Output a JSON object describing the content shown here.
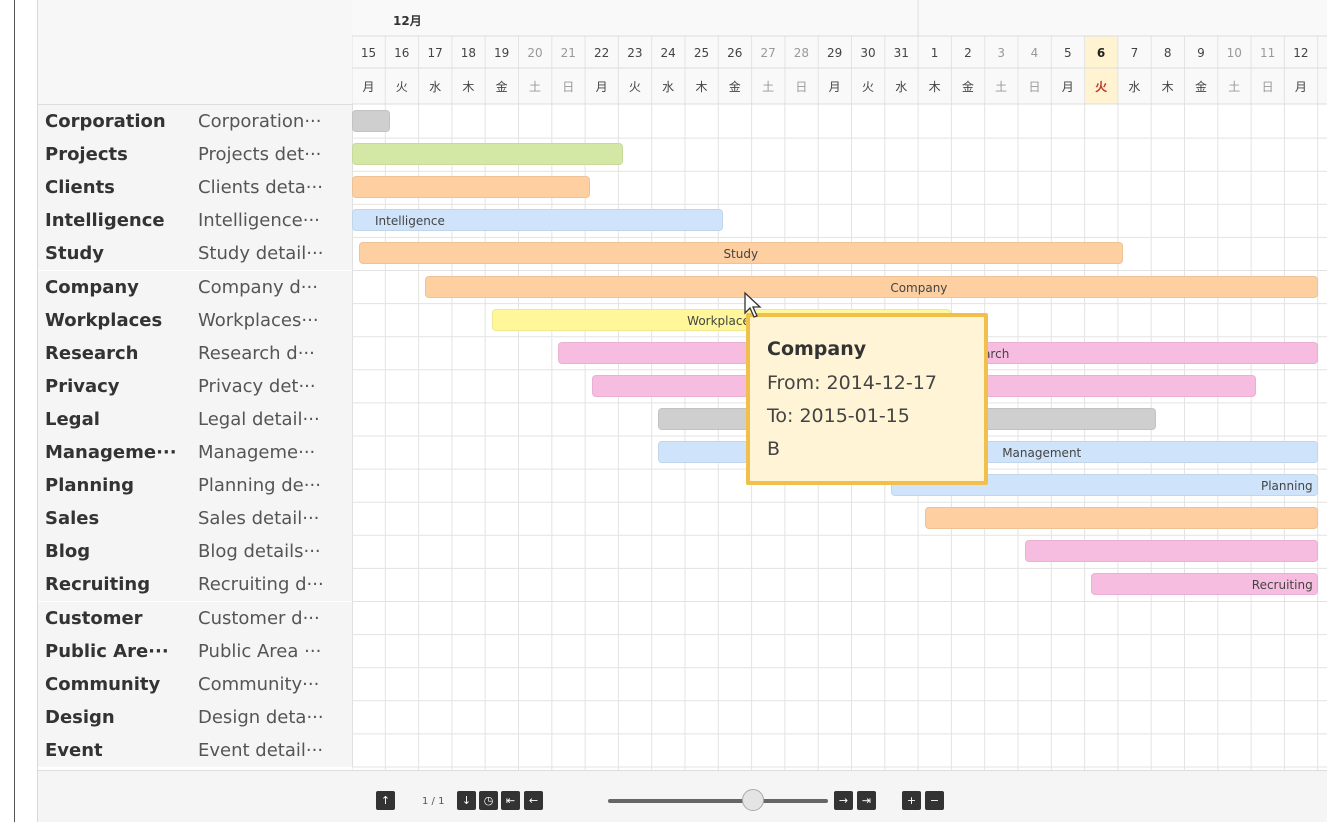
{
  "gantt": {
    "month_label": "12月",
    "days": [
      "15",
      "16",
      "17",
      "18",
      "19",
      "20",
      "21",
      "22",
      "23",
      "24",
      "25",
      "26",
      "27",
      "28",
      "29",
      "30",
      "31",
      "1",
      "2",
      "3",
      "4",
      "5",
      "6",
      "7",
      "8",
      "9",
      "10",
      "11",
      "12"
    ],
    "weekdays": [
      "月",
      "火",
      "水",
      "木",
      "金",
      "土",
      "日",
      "月",
      "火",
      "水",
      "木",
      "金",
      "土",
      "日",
      "月",
      "火",
      "水",
      "木",
      "金",
      "土",
      "日",
      "月",
      "火",
      "水",
      "木",
      "金",
      "土",
      "日",
      "月"
    ],
    "today_index": 22,
    "rows": [
      {
        "name": "Corporation",
        "desc": "Corporation···"
      },
      {
        "name": "Projects",
        "desc": "Projects det···"
      },
      {
        "name": "Clients",
        "desc": "Clients deta···"
      },
      {
        "name": "Intelligence",
        "desc": "Intelligence···"
      },
      {
        "name": "Study",
        "desc": "Study detail···"
      },
      {
        "name": "Company",
        "desc": "Company d···"
      },
      {
        "name": "Workplaces",
        "desc": "Workplaces···"
      },
      {
        "name": "Research",
        "desc": "Research d···"
      },
      {
        "name": "Privacy",
        "desc": "Privacy det···"
      },
      {
        "name": "Legal",
        "desc": "Legal detail···"
      },
      {
        "name": "Manageme···",
        "desc": "Manageme···"
      },
      {
        "name": "Planning",
        "desc": "Planning de···"
      },
      {
        "name": "Sales",
        "desc": "Sales detail···"
      },
      {
        "name": "Blog",
        "desc": "Blog details···"
      },
      {
        "name": "Recruiting",
        "desc": "Recruiting d···"
      },
      {
        "name": "Customer",
        "desc": "Customer d···"
      },
      {
        "name": "Public Are···",
        "desc": "Public Area ···"
      },
      {
        "name": "Community",
        "desc": "Community···"
      },
      {
        "name": "Design",
        "desc": "Design deta···"
      },
      {
        "name": "Event",
        "desc": "Event detail···"
      }
    ],
    "bars": [
      {
        "row": 0,
        "start": 0,
        "end": 1.15,
        "label": "",
        "color": "#cfcfcf",
        "label_pos": "center"
      },
      {
        "row": 1,
        "start": 0,
        "end": 8.15,
        "label": "",
        "color": "#d4e8a6",
        "label_pos": "center"
      },
      {
        "row": 2,
        "start": 0,
        "end": 7.15,
        "label": "",
        "color": "#fdcfa1",
        "label_pos": "center"
      },
      {
        "row": 3,
        "start": 0,
        "end": 11.15,
        "label": "Intelligence",
        "color": "#cfe4fa",
        "label_pos": "left"
      },
      {
        "row": 4,
        "start": 0.2,
        "end": 23.15,
        "label": "Study",
        "color": "#fdcfa1",
        "label_pos": "center"
      },
      {
        "row": 5,
        "start": 2.2,
        "end": 29,
        "label": "Company",
        "color": "#fdcfa1",
        "label_pos": "right"
      },
      {
        "row": 6,
        "start": 4.2,
        "end": 18,
        "label": "Workplaces",
        "color": "#fff79a",
        "label_pos": "center"
      },
      {
        "row": 7,
        "start": 6.2,
        "end": 29,
        "label": "Research",
        "color": "#f7bde0",
        "label_pos": "right"
      },
      {
        "row": 8,
        "start": 7.2,
        "end": 27.15,
        "label": "",
        "color": "#f7bde0",
        "label_pos": "center"
      },
      {
        "row": 9,
        "start": 9.2,
        "end": 24.15,
        "label": "",
        "color": "#cfcfcf",
        "label_pos": "center"
      },
      {
        "row": 10,
        "start": 9.2,
        "end": 29,
        "label": "Management",
        "color": "#cfe4fa",
        "label_pos": "right"
      },
      {
        "row": 11,
        "start": 16.2,
        "end": 29,
        "label": "Planning",
        "color": "#cfe4fa",
        "label_pos": "end"
      },
      {
        "row": 12,
        "start": 17.2,
        "end": 29,
        "label": "",
        "color": "#fdcfa1",
        "label_pos": "center"
      },
      {
        "row": 13,
        "start": 20.2,
        "end": 29,
        "label": "",
        "color": "#f7bde0",
        "label_pos": "center"
      },
      {
        "row": 14,
        "start": 22.2,
        "end": 29,
        "label": "Recruiting",
        "color": "#f7bde0",
        "label_pos": "end"
      }
    ]
  },
  "tooltip": {
    "title": "Company",
    "from": "From: 2014-12-17",
    "to": "To: 2015-01-15",
    "extra": "B"
  },
  "footer": {
    "page_indicator": "1 / 1",
    "zoom_level": 0.66,
    "buttons": [
      {
        "name": "row-up-button",
        "glyph": "↑"
      },
      {
        "name": "row-down-button",
        "glyph": "↓"
      },
      {
        "name": "today-button",
        "glyph": "◷"
      },
      {
        "name": "scroll-start-button",
        "glyph": "⇤"
      },
      {
        "name": "scroll-left-button",
        "glyph": "←"
      },
      {
        "name": "scroll-right-button",
        "glyph": "→"
      },
      {
        "name": "scroll-end-button",
        "glyph": "⇥"
      },
      {
        "name": "zoom-in-button",
        "glyph": "+"
      },
      {
        "name": "zoom-out-button",
        "glyph": "−"
      }
    ]
  },
  "colors": {
    "grid_line": "#e3e3e3",
    "weekend_bg": "#fbfbfb",
    "today_bg": "#fff3d2",
    "tooltip_border": "#f0bf4c"
  }
}
